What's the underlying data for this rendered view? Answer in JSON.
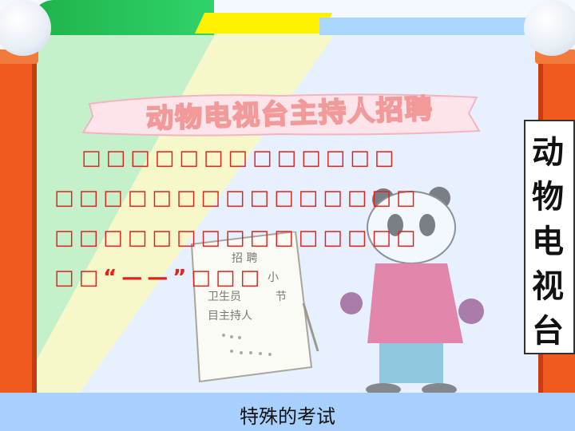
{
  "banner": {
    "title": "动物电视台主持人招聘"
  },
  "side_sign": {
    "chars": [
      "动",
      "物",
      "电",
      "视",
      "台"
    ]
  },
  "notice_board": {
    "lines": [
      "招 聘",
      "小",
      "节",
      "卫生员",
      "目主持人"
    ]
  },
  "paragraph": {
    "lines": [
      "□□□□□□□□□□□□□",
      "□□□□□□□□□□□□□□□",
      "□□□□□□□□□□□□□□□",
      "□□"
    ],
    "quote_mark": "“——”",
    "tail": "□□□"
  },
  "footer": {
    "title": "特殊的考试"
  },
  "colors": {
    "text_red": "#e0221c",
    "pillar_orange": "#f05a1f",
    "footer_blue": "#a8d0ff"
  }
}
